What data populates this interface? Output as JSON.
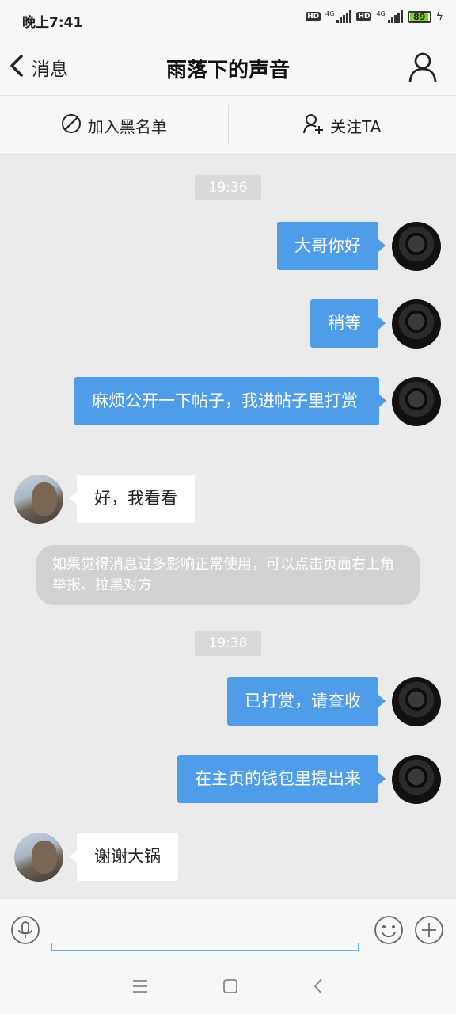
{
  "status_bar": {
    "time": "晚上7:41",
    "network_1": "4G",
    "network_2": "4G",
    "hd_label": "HD",
    "battery": "89"
  },
  "header": {
    "back_label": "消息",
    "title": "雨落下的声音"
  },
  "actions": {
    "blacklist_label": "加入黑名单",
    "follow_label": "关注TA"
  },
  "messages": {
    "ts1": "19:36",
    "m1": "大哥你好",
    "m2": "稍等",
    "m3": "麻烦公开一下帖子，我进帖子里打赏",
    "m4": "好，我看看",
    "system_notice": "如果觉得消息过多影响正常使用，可以点击页面右上角举报、拉黑对方",
    "ts2": "19:38",
    "m5": "已打赏，请查收",
    "m6": "在主页的钱包里提出来",
    "m7": "谢谢大锅"
  },
  "icons": {
    "back": "chevron-left-icon",
    "profile": "user-icon",
    "blacklist": "block-icon",
    "follow": "add-user-icon",
    "voice": "microphone-icon",
    "emoji": "smiley-icon",
    "more": "plus-icon"
  },
  "colors": {
    "outgoing_bubble": "#4f9ce9",
    "incoming_bubble": "#ffffff",
    "input_underline": "#56b6e0",
    "battery_fill": "#7ed321"
  }
}
